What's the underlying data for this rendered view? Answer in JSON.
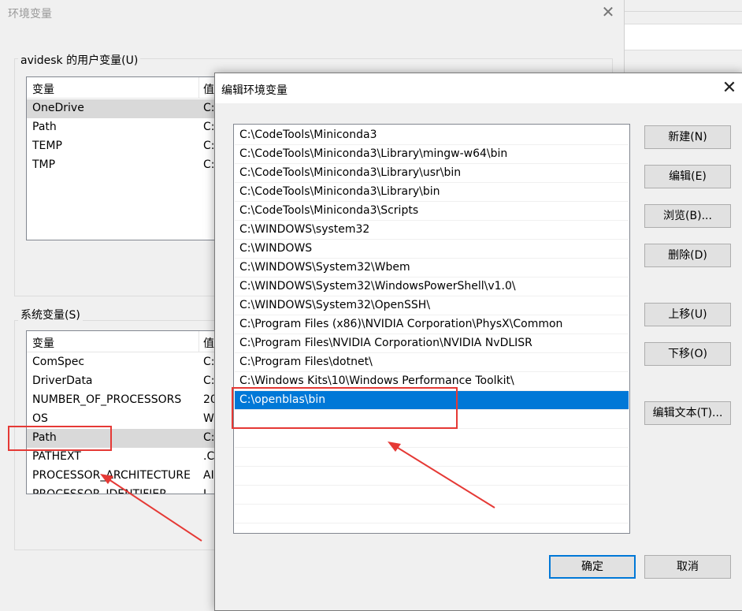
{
  "main_window": {
    "title": "环境变量",
    "close_glyph": "✕",
    "user_vars": {
      "group_label": "avidesk 的用户变量(U)",
      "header": {
        "col_variable": "变量",
        "col_value": "值"
      },
      "rows": [
        {
          "name": "OneDrive",
          "value": "C:"
        },
        {
          "name": "Path",
          "value": "C:"
        },
        {
          "name": "TEMP",
          "value": "C:"
        },
        {
          "name": "TMP",
          "value": "C:"
        }
      ]
    },
    "system_vars": {
      "group_label": "系统变量(S)",
      "header": {
        "col_variable": "变量",
        "col_value": "值"
      },
      "rows": [
        {
          "name": "ComSpec",
          "value": "C:"
        },
        {
          "name": "DriverData",
          "value": "C:"
        },
        {
          "name": "NUMBER_OF_PROCESSORS",
          "value": "20"
        },
        {
          "name": "OS",
          "value": "W"
        },
        {
          "name": "Path",
          "value": "C:"
        },
        {
          "name": "PATHEXT",
          "value": ".C"
        },
        {
          "name": "PROCESSOR_ARCHITECTURE",
          "value": "AI"
        },
        {
          "name": "PROCESSOR_IDENTIFIER",
          "value": "I"
        }
      ]
    }
  },
  "edit_dialog": {
    "title": "编辑环境变量",
    "close_glyph": "✕",
    "paths": [
      "C:\\CodeTools\\Miniconda3",
      "C:\\CodeTools\\Miniconda3\\Library\\mingw-w64\\bin",
      "C:\\CodeTools\\Miniconda3\\Library\\usr\\bin",
      "C:\\CodeTools\\Miniconda3\\Library\\bin",
      "C:\\CodeTools\\Miniconda3\\Scripts",
      "C:\\WINDOWS\\system32",
      "C:\\WINDOWS",
      "C:\\WINDOWS\\System32\\Wbem",
      "C:\\WINDOWS\\System32\\WindowsPowerShell\\v1.0\\",
      "C:\\WINDOWS\\System32\\OpenSSH\\",
      "C:\\Program Files (x86)\\NVIDIA Corporation\\PhysX\\Common",
      "C:\\Program Files\\NVIDIA Corporation\\NVIDIA NvDLISR",
      "C:\\Program Files\\dotnet\\",
      "C:\\Windows Kits\\10\\Windows Performance Toolkit\\",
      "C:\\openblas\\bin"
    ],
    "selected_path": "C:\\openblas\\bin",
    "buttons": {
      "new": "新建(N)",
      "edit": "编辑(E)",
      "browse": "浏览(B)...",
      "delete": "删除(D)",
      "move_up": "上移(U)",
      "move_down": "下移(O)",
      "edit_text": "编辑文本(T)...",
      "ok": "确定",
      "cancel": "取消"
    }
  },
  "annotations": {
    "highlight_color": "#e53935",
    "selection_color": "#0078d7"
  }
}
